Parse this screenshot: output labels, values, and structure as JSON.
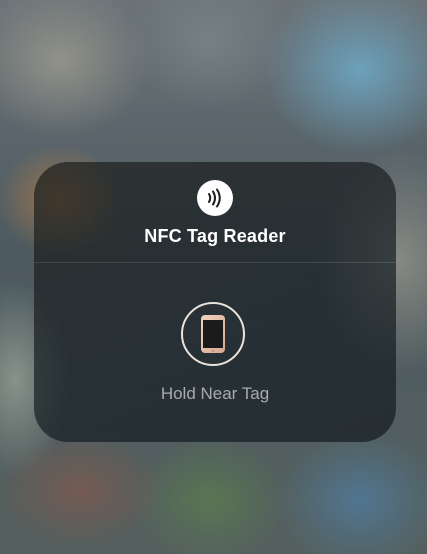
{
  "nfc_sheet": {
    "title": "NFC Tag Reader",
    "status": "Hold Near Tag",
    "badge_icon": "nfc-waves-icon",
    "prompt_icon": "phone-icon"
  },
  "colors": {
    "badge_bg": "#ffffff",
    "title_text": "#ffffff",
    "status_text": "#a8abad",
    "phone_accent": "#e3b8a2"
  }
}
